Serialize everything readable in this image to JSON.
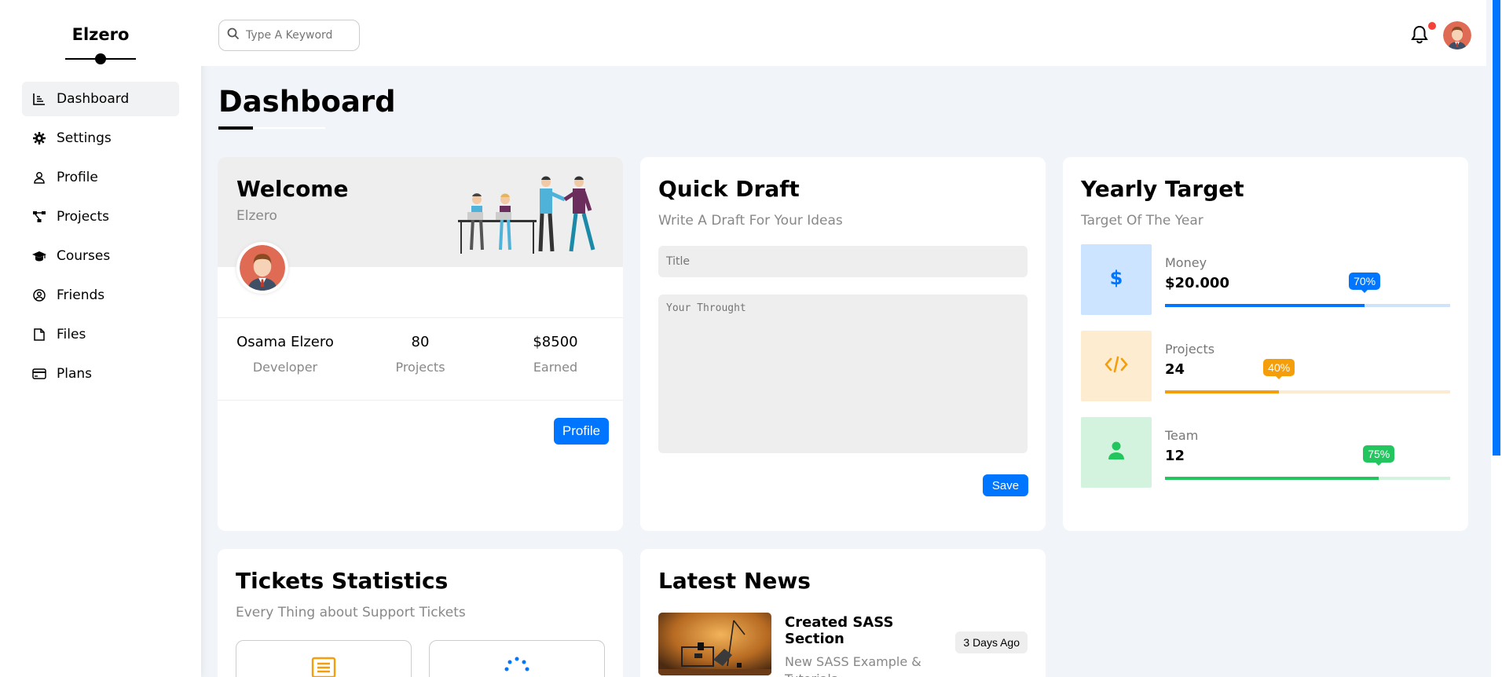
{
  "sidebar": {
    "brand": "Elzero",
    "items": [
      {
        "label": "Dashboard",
        "icon": "chart-icon"
      },
      {
        "label": "Settings",
        "icon": "gear-icon"
      },
      {
        "label": "Profile",
        "icon": "user-icon"
      },
      {
        "label": "Projects",
        "icon": "diagram-icon"
      },
      {
        "label": "Courses",
        "icon": "graduation-cap-icon"
      },
      {
        "label": "Friends",
        "icon": "user-circle-icon"
      },
      {
        "label": "Files",
        "icon": "file-icon"
      },
      {
        "label": "Plans",
        "icon": "credit-card-icon"
      }
    ]
  },
  "header": {
    "search_placeholder": "Type A Keyword"
  },
  "page": {
    "title": "Dashboard"
  },
  "welcome": {
    "title": "Welcome",
    "subtitle": "Elzero",
    "stats": [
      {
        "value": "Osama Elzero",
        "label": "Developer"
      },
      {
        "value": "80",
        "label": "Projects"
      },
      {
        "value": "$8500",
        "label": "Earned"
      }
    ],
    "button": "Profile"
  },
  "draft": {
    "title": "Quick Draft",
    "subtitle": "Write A Draft For Your Ideas",
    "title_placeholder": "Title",
    "body_placeholder": "Your Throught",
    "button": "Save"
  },
  "target": {
    "title": "Yearly Target",
    "subtitle": "Target Of The Year",
    "rows": [
      {
        "label": "Money",
        "value": "$20.000",
        "percent": "70%",
        "progress": 0.7,
        "color": "#0075ff",
        "bg": "#cce4ff",
        "track": "#cfe3fb",
        "icon": "dollar-icon"
      },
      {
        "label": "Projects",
        "value": "24",
        "percent": "40%",
        "progress": 0.4,
        "color": "#f59e0b",
        "bg": "#fdecd0",
        "track": "#fcebd0",
        "icon": "code-icon"
      },
      {
        "label": "Team",
        "value": "12",
        "percent": "75%",
        "progress": 0.75,
        "color": "#22c55e",
        "bg": "#d3f3df",
        "track": "#d3f3df",
        "icon": "user-icon"
      }
    ]
  },
  "tickets": {
    "title": "Tickets Statistics",
    "subtitle": "Every Thing about Support Tickets"
  },
  "news": {
    "title": "Latest News",
    "item_title": "Created SASS Section",
    "item_desc": "New SASS Example & Tutorials",
    "item_date": "3 Days Ago"
  }
}
